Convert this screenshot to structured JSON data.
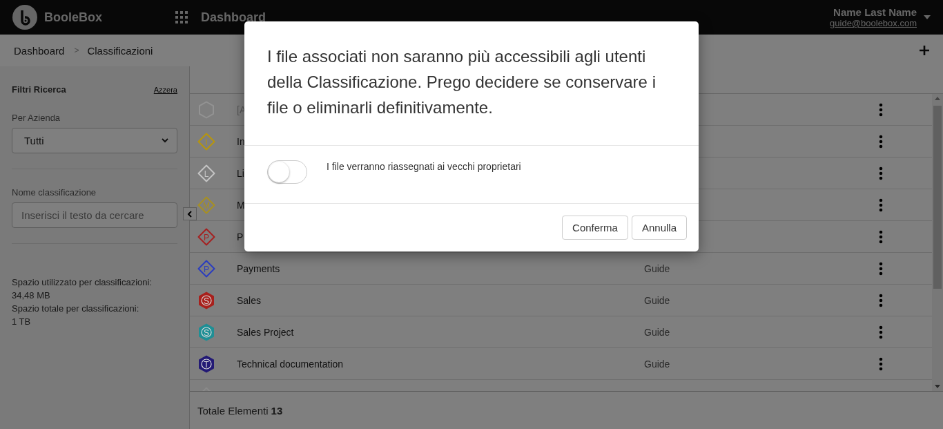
{
  "header": {
    "brand": "BooleBox",
    "section": "Dashboard",
    "user_name": "Name Last Name",
    "user_email": "guide@boolebox.com"
  },
  "breadcrumb": {
    "items": [
      "Dashboard",
      "Classificazioni"
    ],
    "separator": ">"
  },
  "sidebar": {
    "title": "Filtri Ricerca",
    "reset": "Azzera",
    "filters": [
      {
        "kind": "select",
        "label": "Per Azienda",
        "value": "Tutti"
      },
      {
        "kind": "text",
        "label": "Nome classificazione",
        "placeholder": "Inserisci il testo da cercare"
      }
    ],
    "usage": [
      "Spazio utilizzato per classificazioni:",
      "34,48 MB",
      "Spazio totale per classificazioni:",
      "1 TB"
    ]
  },
  "list": {
    "rows": [
      {
        "name": "[A",
        "disabled": true,
        "icon": {
          "kind": "hexagon",
          "color": "#939393"
        }
      },
      {
        "name": "In",
        "disabled": false,
        "icon": {
          "kind": "diamond",
          "letter": "I",
          "color": "#b8960a"
        }
      },
      {
        "name": "Li",
        "disabled": false,
        "icon": {
          "kind": "diamond",
          "letter": "L",
          "color": "#c4c4c4"
        }
      },
      {
        "name": "M",
        "disabled": false,
        "icon": {
          "kind": "diamond",
          "letter": "M",
          "color": "#a89020"
        }
      },
      {
        "name": "P",
        "disabled": false,
        "icon": {
          "kind": "diamond",
          "letter": "P",
          "color": "#a52020"
        }
      },
      {
        "name": "Payments",
        "owner": "Guide",
        "disabled": false,
        "icon": {
          "kind": "diamond",
          "letter": "P",
          "color": "#2a3cc0"
        }
      },
      {
        "name": "Sales",
        "owner": "Guide",
        "disabled": false,
        "icon": {
          "kind": "badge",
          "letter": "S",
          "color": "#a8201c"
        }
      },
      {
        "name": "Sales Project",
        "owner": "Guide",
        "disabled": false,
        "icon": {
          "kind": "badge",
          "letter": "S",
          "color": "#1f8f95"
        }
      },
      {
        "name": "Technical documentation",
        "owner": "Guide",
        "disabled": false,
        "icon": {
          "kind": "badge",
          "letter": "T",
          "color": "#231a75"
        }
      },
      {
        "icon": {
          "kind": "diamond",
          "color": "#8a8a8a"
        }
      }
    ],
    "total_label": "Totale Elementi",
    "total_value": "13"
  },
  "modal": {
    "message": "I file associati non saranno più accessibili agli utenti della Classificazione. Prego decidere se conservare i file o eliminarli definitivamente.",
    "toggle": {
      "label": "I file verranno riassegnati ai vecchi proprietari",
      "on": false
    },
    "buttons": [
      "Conferma",
      "Annulla"
    ]
  }
}
